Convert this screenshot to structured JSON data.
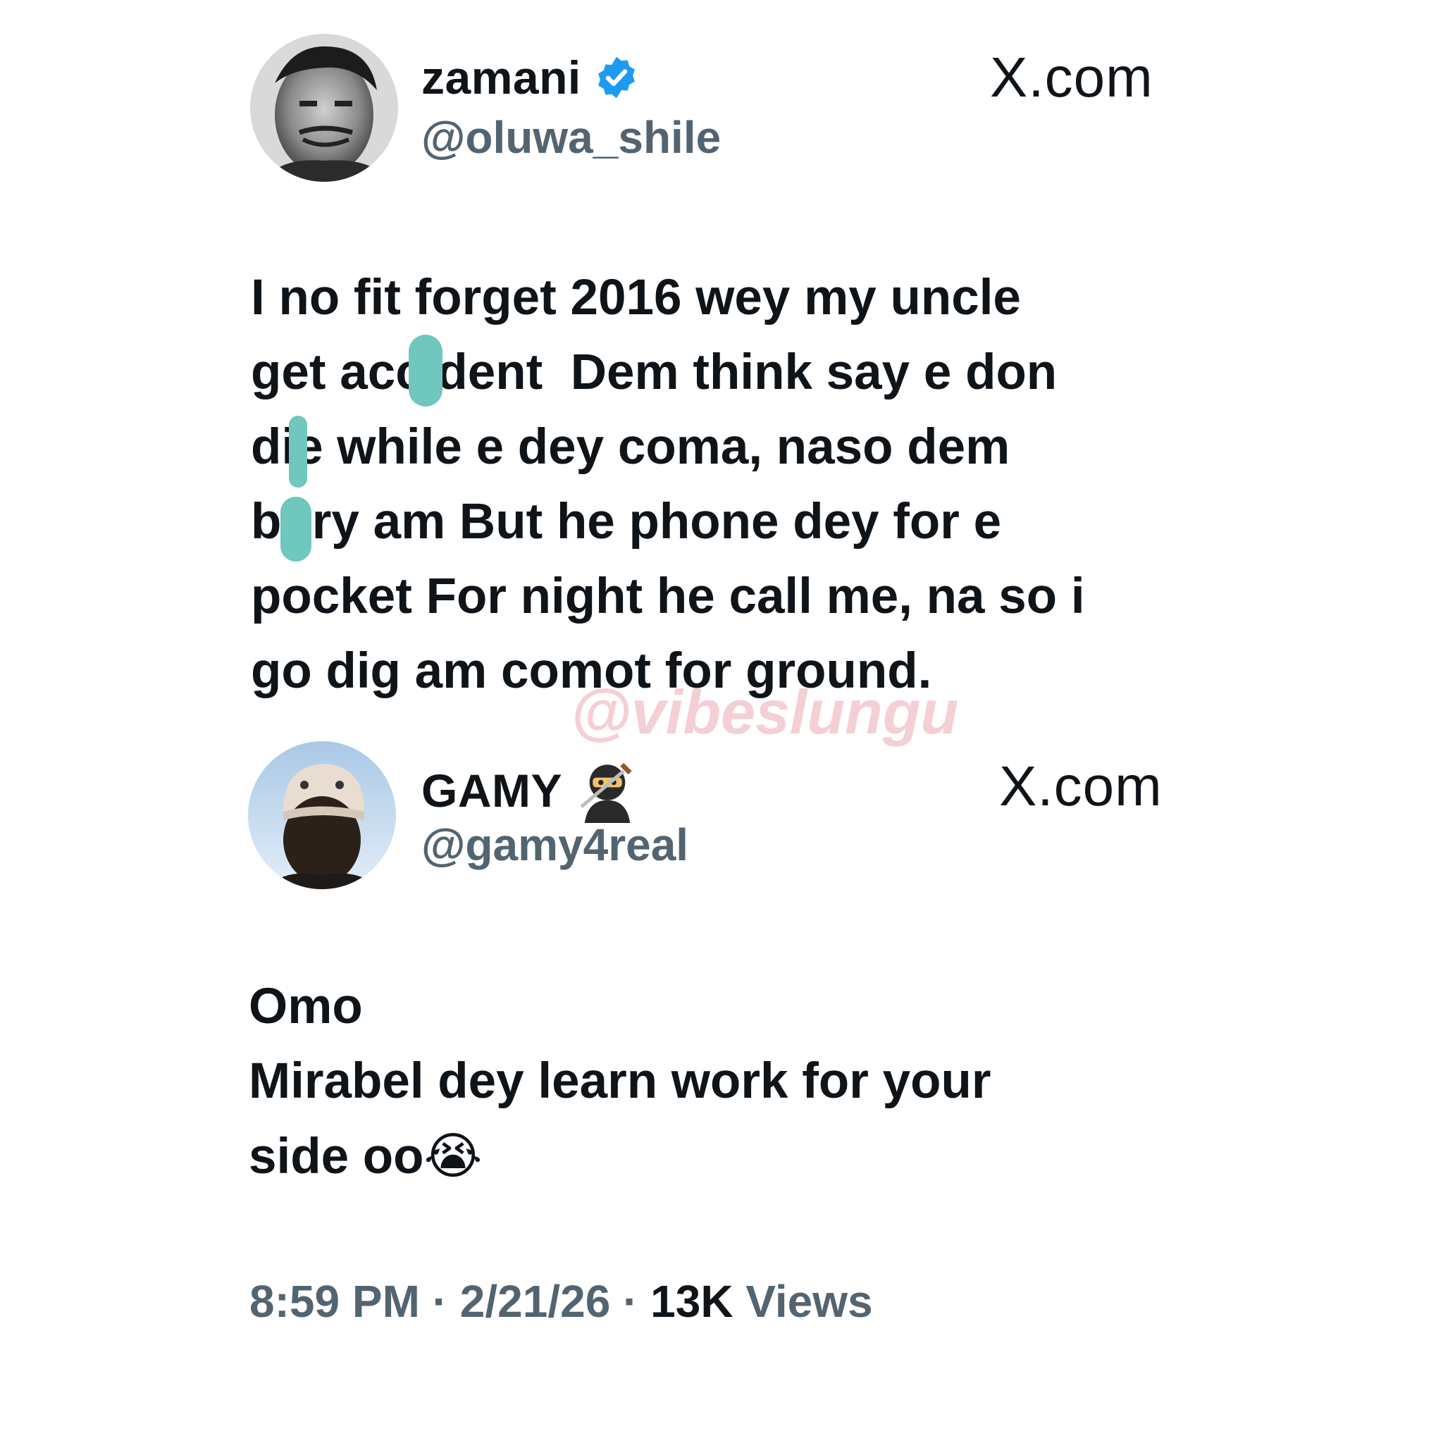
{
  "posts": [
    {
      "display_name": "zamani",
      "handle": "@oluwa_shile",
      "source_brand": "X.com",
      "verified": true,
      "avatar_icon": "avatar-photo",
      "text": "I no fit forget 2016 wey my uncle\nget accident  Dem think say e don\ndie while e dey coma, naso dem\nbury am But he phone dey for e\npocket For night he call me, na so i\ngo dig am comot for ground."
    },
    {
      "display_name": "GAMY",
      "handle": "@gamy4real",
      "source_brand": "X.com",
      "badge_icon": "ninja-emoji-icon",
      "avatar_icon": "avatar-photo",
      "text": "Omo\nMirabel dey learn work for your\nside oo",
      "trailing_emoji": "😭"
    }
  ],
  "watermark": "@vibeslungu",
  "meta": {
    "time": "8:59 PM",
    "date": "2/21/26",
    "separator": "·",
    "views_count": "13K",
    "views_label": "Views"
  },
  "colors": {
    "text": "#0f1419",
    "secondary": "#536471",
    "verified": "#1d9bf0",
    "redaction": "#6fc7bd",
    "watermark": "#f3c7cc"
  }
}
